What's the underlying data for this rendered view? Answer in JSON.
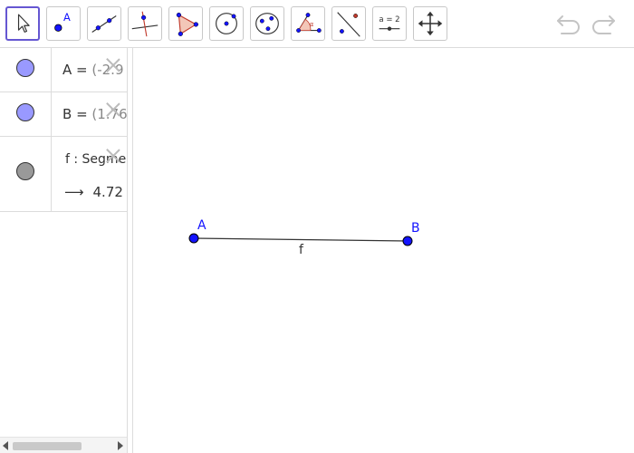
{
  "toolbar": {
    "tools": [
      {
        "name": "move-tool",
        "active": true
      },
      {
        "name": "point-tool",
        "label": "A"
      },
      {
        "name": "line-tool"
      },
      {
        "name": "perpendicular-line-tool"
      },
      {
        "name": "polygon-tool"
      },
      {
        "name": "circle-center-point-tool"
      },
      {
        "name": "circle-three-points-tool"
      },
      {
        "name": "angle-tool",
        "label": "α"
      },
      {
        "name": "reflect-about-line-tool"
      },
      {
        "name": "slider-tool",
        "label": "a = 2"
      },
      {
        "name": "move-graphics-view-tool"
      }
    ],
    "undo_icon": "undo-icon",
    "redo_icon": "redo-icon"
  },
  "algebra": {
    "rows": [
      {
        "lhs": "A",
        "eq": " = ",
        "rhs": "(-2.9",
        "marble_color": "#9999ff"
      },
      {
        "lhs": "B",
        "eq": " = ",
        "rhs": "(1.76",
        "marble_color": "#9999ff"
      },
      {
        "definition": "f : Segme",
        "value": "4.72",
        "arrow": "⟶",
        "marble_color": "#999999"
      }
    ]
  },
  "graphics": {
    "points": [
      {
        "label": "A",
        "color": "#1414ff"
      },
      {
        "label": "B",
        "color": "#1414ff"
      }
    ],
    "segment_label": "f"
  },
  "colors": {
    "accent": "#6557d2",
    "point": "#1414ff"
  }
}
